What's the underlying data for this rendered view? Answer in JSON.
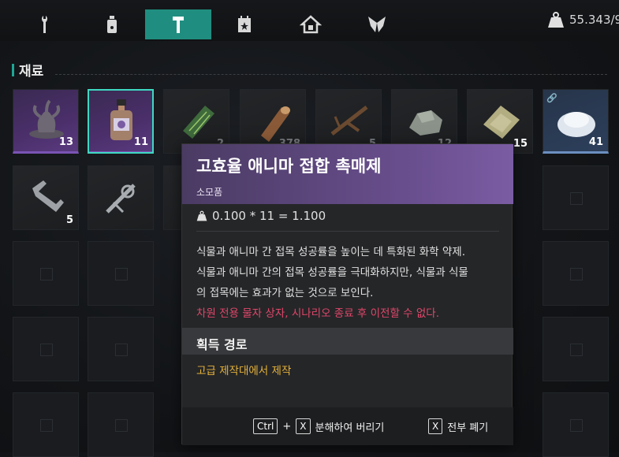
{
  "topbar": {
    "tabs": [
      {
        "icon": "wrench-icon"
      },
      {
        "icon": "bottle-icon"
      },
      {
        "icon": "hammer-icon",
        "active": true
      },
      {
        "icon": "calendar-star-icon"
      },
      {
        "icon": "house-icon"
      },
      {
        "icon": "wings-icon"
      }
    ],
    "weight_icon": "weight-icon",
    "weight_value": "55.343/9"
  },
  "section": {
    "title": "재료"
  },
  "inventory": {
    "row1": [
      {
        "name": "tentacle-figurine",
        "count": "13",
        "rarity": "purple"
      },
      {
        "name": "catalyst-bottle",
        "count": "11",
        "rarity": "purple",
        "selected": true
      },
      {
        "name": "circuit-board",
        "count": "2",
        "rarity": "dim"
      },
      {
        "name": "wooden-log",
        "count": "378",
        "rarity": "dim"
      },
      {
        "name": "branch",
        "count": "5",
        "rarity": "dim"
      },
      {
        "name": "stone",
        "count": "12",
        "rarity": "dim"
      },
      {
        "name": "fabric-scrap",
        "count": "15",
        "rarity": "dim"
      },
      {
        "name": "salt-crystals",
        "count": "41",
        "rarity": "blue"
      }
    ],
    "row2_counts": [
      "5",
      ""
    ]
  },
  "tooltip": {
    "title": "고효율 애니마 접합 촉매제",
    "type": "소모품",
    "weight": "0.100 * 11 = 1.100",
    "desc_lines": [
      "식물과 애니마 간 접목 성공률을 높이는 데 특화된 화학 약제.",
      "식물과 애니마 간의 접목 성공률을 극대화하지만, 식물과 식물",
      "의 접목에는 효과가 없는 것으로 보인다."
    ],
    "warning": "차원 전용 물자 상자, 시나리오 종료 후 이전할 수 없다.",
    "source_title": "획득 경로",
    "source": "고급 제작대에서 제작",
    "footer": {
      "ctrl_key": "Ctrl",
      "plus": "+",
      "x_key": "X",
      "disassemble": "분해하여 버리기",
      "discard_all": "전부 폐기"
    }
  },
  "colors": {
    "accent": "#1f8e80",
    "selected": "#3fd8c2",
    "warning": "#e0476a",
    "source": "#e5b23a",
    "rare_purple": "#6a4f8f"
  }
}
